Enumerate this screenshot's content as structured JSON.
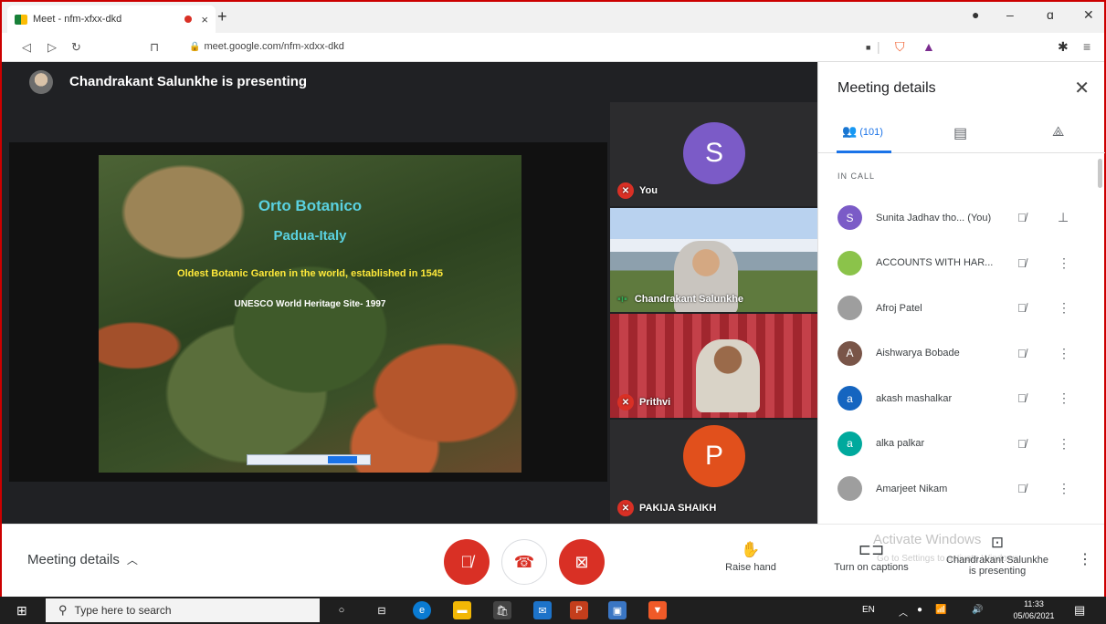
{
  "browser": {
    "tab_title": "Meet - nfm-xfxx-dkd",
    "tab_close": "×",
    "new_tab": "+",
    "url": "meet.google.com/nfm-xdxx-dkd",
    "win_min": "–",
    "win_max": "ɑ",
    "win_close": "✕"
  },
  "presenter": {
    "text": "Chandrakant Salunkhe is presenting"
  },
  "slide": {
    "line1": "Orto Botanico",
    "line2": "Padua-Italy",
    "line3": "Oldest Botanic Garden in the world, established in 1545",
    "line4": "UNESCO World Heritage Site- 1997"
  },
  "tiles": [
    {
      "name": "You",
      "initial": "S"
    },
    {
      "name": "Chandrakant Salunkhe"
    },
    {
      "name": "Prithvi"
    },
    {
      "name": "PAKIJA SHAIKH",
      "initial": "P"
    }
  ],
  "panel": {
    "title": "Meeting details",
    "people_count": "(101)",
    "in_call_label": "IN CALL",
    "participants": [
      {
        "name": "Sunita Jadhav tho... (You)",
        "initial": "S",
        "color": "#7b5bc7"
      },
      {
        "name": "ACCOUNTS WITH HAR...",
        "initial": "",
        "color": "#8bc34a"
      },
      {
        "name": "Afroj Patel",
        "initial": "",
        "color": "#9e9e9e"
      },
      {
        "name": "Aishwarya Bobade",
        "initial": "A",
        "color": "#795548"
      },
      {
        "name": "akash mashalkar",
        "initial": "a",
        "color": "#1565c0"
      },
      {
        "name": "alka palkar",
        "initial": "a",
        "color": "#00a99d"
      },
      {
        "name": "Amarjeet Nikam",
        "initial": "",
        "color": "#9e9e9e"
      }
    ]
  },
  "controls": {
    "meeting_details": "Meeting details",
    "raise_hand": "Raise hand",
    "captions": "Turn on captions",
    "presenting": "Chandrakant Salunkhe is presenting",
    "activate_title": "Activate Windows",
    "activate_sub": "Go to Settings to activate Windows."
  },
  "taskbar": {
    "search_placeholder": "Type here to search",
    "lang": "EN",
    "time": "11:33",
    "date": "05/06/2021"
  }
}
